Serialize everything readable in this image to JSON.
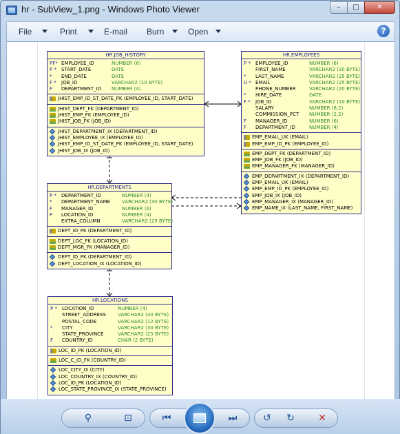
{
  "window": {
    "title": "hr - SubView_1.png - Windows Photo Viewer",
    "min": "–",
    "max": "□",
    "close": "✕"
  },
  "menu": [
    {
      "label": "File",
      "has_caret": true
    },
    {
      "label": "Print",
      "has_caret": true
    },
    {
      "label": "E-mail",
      "has_caret": false
    },
    {
      "label": "Burn",
      "has_caret": true
    },
    {
      "label": "Open",
      "has_caret": true
    }
  ],
  "help": "?",
  "toolbar": {
    "zoom": "⚲",
    "actual_size": "⊡",
    "previous": "⏮",
    "next": "⏭",
    "rotate_ccw": "↺",
    "rotate_cw": "↻",
    "delete": "✕"
  },
  "diagram": {
    "job_history": {
      "title": "HR.JOB_HISTORY",
      "columns": [
        {
          "flag": "PF*",
          "name": "EMPLOYEE_ID",
          "type": "NUMBER (6)"
        },
        {
          "flag": "P *",
          "name": "START_DATE",
          "type": "DATE"
        },
        {
          "flag": "  *",
          "name": "END_DATE",
          "type": "DATE"
        },
        {
          "flag": "F *",
          "name": "JOB_ID",
          "type": "VARCHAR2 (10 BYTE)"
        },
        {
          "flag": "F",
          "name": "DEPARTMENT_ID",
          "type": "NUMBER (4)"
        }
      ],
      "pk": [
        "JHIST_EMP_ID_ST_DATE_PK (EMPLOYEE_ID, START_DATE)"
      ],
      "fk": [
        "JHIST_DEPT_FK (DEPARTMENT_ID)",
        "JHIST_EMP_FK (EMPLOYEE_ID)",
        "JHIST_JOB_FK (JOB_ID)"
      ],
      "ix": [
        "JHIST_DEPARTMENT_IX (DEPARTMENT_ID)",
        "JHIST_EMPLOYEE_IX (EMPLOYEE_ID)",
        "JHIST_EMP_ID_ST_DATE_PK (EMPLOYEE_ID, START_DATE)",
        "JHIST_JOB_IX (JOB_ID)"
      ]
    },
    "employees": {
      "title": "HR.EMPLOYEES",
      "columns": [
        {
          "flag": "P *",
          "name": "EMPLOYEE_ID",
          "type": "NUMBER (6)"
        },
        {
          "flag": "",
          "name": "FIRST_NAME",
          "type": "VARCHAR2 (20 BYTE)"
        },
        {
          "flag": "  *",
          "name": "LAST_NAME",
          "type": "VARCHAR2 (25 BYTE)"
        },
        {
          "flag": "U *",
          "name": "EMAIL",
          "type": "VARCHAR2 (25 BYTE)"
        },
        {
          "flag": "",
          "name": "PHONE_NUMBER",
          "type": "VARCHAR2 (20 BYTE)"
        },
        {
          "flag": "  *",
          "name": "HIRE_DATE",
          "type": "DATE"
        },
        {
          "flag": "F *",
          "name": "JOB_ID",
          "type": "VARCHAR2 (10 BYTE)"
        },
        {
          "flag": "",
          "name": "SALARY",
          "type": "NUMBER (8,2)"
        },
        {
          "flag": "",
          "name": "COMMISSION_PCT",
          "type": "NUMBER (2,2)"
        },
        {
          "flag": "F",
          "name": "MANAGER_ID",
          "type": "NUMBER (6)"
        },
        {
          "flag": "F",
          "name": "DEPARTMENT_ID",
          "type": "NUMBER (4)"
        }
      ],
      "pk": [
        "EMP_EMAIL_UK (EMAIL)",
        "EMP_EMP_ID_PK (EMPLOYEE_ID)"
      ],
      "fk": [
        "EMP_DEPT_FK (DEPARTMENT_ID)",
        "EMP_JOB_FK (JOB_ID)",
        "EMP_MANAGER_FK (MANAGER_ID)"
      ],
      "ix": [
        "EMP_DEPARTMENT_IX (DEPARTMENT_ID)",
        "EMP_EMAIL_UK (EMAIL)",
        "EMP_EMP_ID_PK (EMPLOYEE_ID)",
        "EMP_JOB_IX (JOB_ID)",
        "EMP_MANAGER_IX (MANAGER_ID)",
        "EMP_NAME_IX (LAST_NAME, FIRST_NAME)"
      ]
    },
    "departments": {
      "title": "HR.DEPARTMENTS",
      "columns": [
        {
          "flag": "P *",
          "name": "DEPARTMENT_ID",
          "type": "NUMBER (4)"
        },
        {
          "flag": "  *",
          "name": "DEPARTMENT_NAME",
          "type": "VARCHAR2 (30 BYTE)"
        },
        {
          "flag": "F",
          "name": "MANAGER_ID",
          "type": "NUMBER (6)"
        },
        {
          "flag": "F",
          "name": "LOCATION_ID",
          "type": "NUMBER (4)"
        },
        {
          "flag": "",
          "name": "EXTRA_COLUMN",
          "type": "VARCHAR2 (25 BYTE)"
        }
      ],
      "pk": [
        "DEPT_ID_PK (DEPARTMENT_ID)"
      ],
      "fk": [
        "DEPT_LOC_FK (LOCATION_ID)",
        "DEPT_MGR_FK (MANAGER_ID)"
      ],
      "ix": [
        "DEPT_ID_PK (DEPARTMENT_ID)",
        "DEPT_LOCATION_IX (LOCATION_ID)"
      ]
    },
    "locations": {
      "title": "HR.LOCATIONS",
      "columns": [
        {
          "flag": "P *",
          "name": "LOCATION_ID",
          "type": "NUMBER (4)"
        },
        {
          "flag": "",
          "name": "STREET_ADDRESS",
          "type": "VARCHAR2 (40 BYTE)"
        },
        {
          "flag": "",
          "name": "POSTAL_CODE",
          "type": "VARCHAR2 (12 BYTE)"
        },
        {
          "flag": "  *",
          "name": "CITY",
          "type": "VARCHAR2 (30 BYTE)"
        },
        {
          "flag": "",
          "name": "STATE_PROVINCE",
          "type": "VARCHAR2 (25 BYTE)"
        },
        {
          "flag": "F",
          "name": "COUNTRY_ID",
          "type": "CHAR (2 BYTE)"
        }
      ],
      "pk": [
        "LOC_ID_PK (LOCATION_ID)"
      ],
      "fk": [
        "LOC_C_ID_FK (COUNTRY_ID)"
      ],
      "ix": [
        "LOC_CITY_IX (CITY)",
        "LOC_COUNTRY_IX (COUNTRY_ID)",
        "LOC_ID_PK (LOCATION_ID)",
        "LOC_STATE_PROVINCE_IX (STATE_PROVINCE)"
      ]
    }
  }
}
